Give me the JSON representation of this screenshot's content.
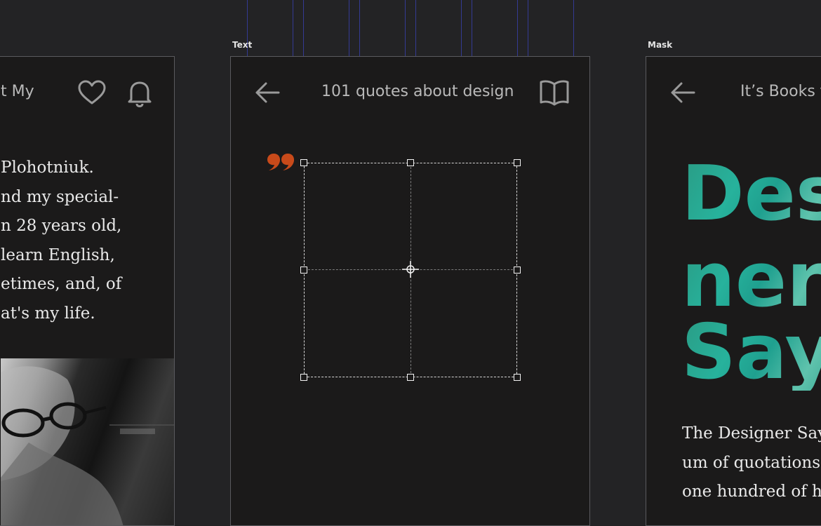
{
  "left_artboard": {
    "title": "t My",
    "bio_lines": [
      " Plohotniuk.",
      "nd my special-",
      "n 28 years old,",
      " learn English,",
      "etimes, and, of",
      "at's my life."
    ]
  },
  "center_artboard": {
    "label": "Text",
    "title": "101 quotes about design"
  },
  "right_artboard": {
    "label": "Mask",
    "title": "It’s Books f",
    "heading_lines": [
      "Des",
      "ner",
      "Say"
    ],
    "body_lines": [
      "The Designer Say",
      "um of quotations",
      "one hundred of h"
    ]
  },
  "colors": {
    "quote_mark": "#c84a1a",
    "guide": "#3b43b8",
    "gradient_teal": "#27b29c"
  }
}
